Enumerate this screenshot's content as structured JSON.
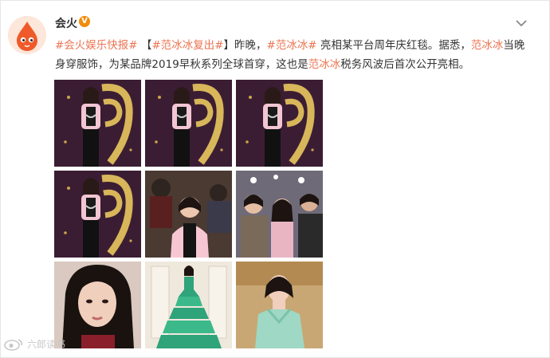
{
  "post": {
    "author": "会火",
    "verified_badge": "V",
    "text_parts": [
      {
        "text": "#会火娱乐快报#",
        "style": "tag"
      },
      {
        "text": " 【",
        "style": "plain"
      },
      {
        "text": "#范冰冰复出#",
        "style": "tag"
      },
      {
        "text": "】昨晚，",
        "style": "plain"
      },
      {
        "text": "#范冰冰#",
        "style": "tag"
      },
      {
        "text": " 亮相某平台周年庆红毯。据悉，",
        "style": "plain"
      },
      {
        "text": "范冰冰",
        "style": "link"
      },
      {
        "text": "当晚身穿服饰，为某品牌2019早秋系列全球首穿，这也是",
        "style": "plain"
      },
      {
        "text": "范冰冰",
        "style": "link"
      },
      {
        "text": "税务风波后首次公开亮相。",
        "style": "plain"
      }
    ],
    "photos": [
      {
        "name": "photo-red-carpet-1",
        "scene": "redcarpet"
      },
      {
        "name": "photo-red-carpet-2",
        "scene": "redcarpet"
      },
      {
        "name": "photo-red-carpet-3",
        "scene": "redcarpet"
      },
      {
        "name": "photo-red-carpet-4",
        "scene": "redcarpet"
      },
      {
        "name": "photo-event-crowd",
        "scene": "crowd"
      },
      {
        "name": "photo-group-selfie",
        "scene": "group"
      },
      {
        "name": "photo-portrait-closeup",
        "scene": "portrait"
      },
      {
        "name": "photo-green-gown",
        "scene": "gown"
      },
      {
        "name": "photo-mint-dress",
        "scene": "mint"
      }
    ]
  },
  "watermark": {
    "text": "六郎读书",
    "icon": "weibo-eye-icon"
  },
  "icons": {
    "avatar": "fire-drop-avatar",
    "menu": "chevron-down-icon"
  },
  "colors": {
    "hashtag": "#eb7350",
    "badge": "#f28c0c",
    "text": "#333333"
  }
}
